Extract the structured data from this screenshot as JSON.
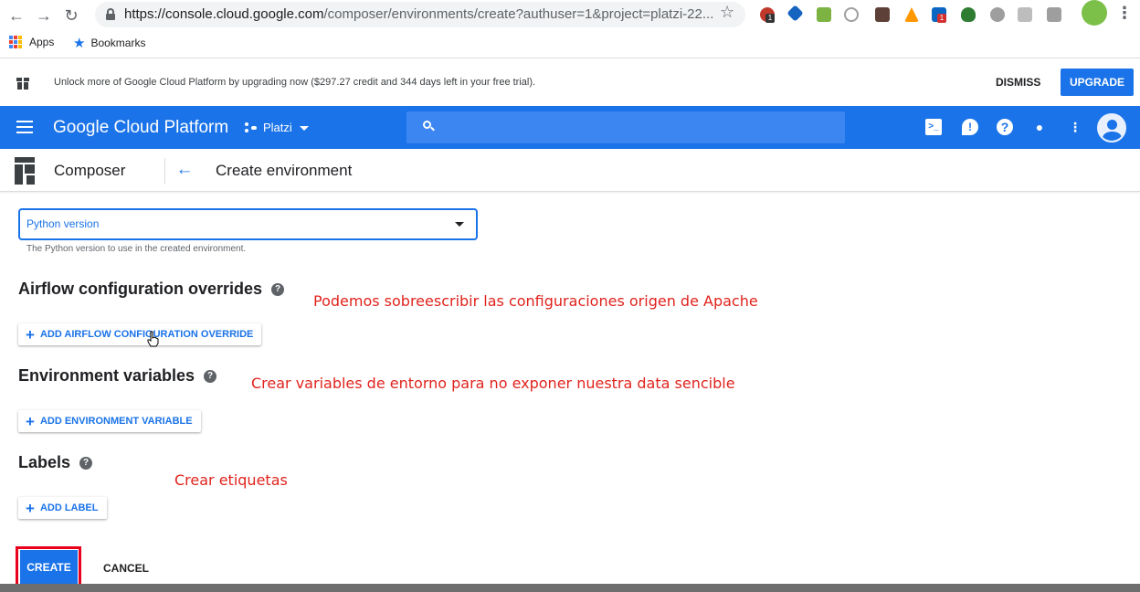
{
  "browser": {
    "url_host": "https://console.cloud.google.com",
    "url_path": "/composer/environments/create?authuser=1&project=platzi-22...",
    "bookmarks": {
      "apps_label": "Apps",
      "bookmarks_label": "Bookmarks"
    },
    "extension_badges": [
      "1",
      "1"
    ]
  },
  "banner": {
    "text": "Unlock more of Google Cloud Platform by upgrading now ($297.27 credit and 344 days left in your free trial).",
    "dismiss_label": "DISMISS",
    "upgrade_label": "UPGRADE"
  },
  "topbar": {
    "title": "Google Cloud Platform",
    "project": "Platzi",
    "brand_color": "#1a73e8"
  },
  "page_header": {
    "product": "Composer",
    "title": "Create environment"
  },
  "form": {
    "python_version": {
      "label": "Python version",
      "helper": "The Python version to use in the created environment."
    },
    "airflow_overrides": {
      "title": "Airflow configuration overrides",
      "button": "ADD AIRFLOW CONFIGURATION OVERRIDE"
    },
    "env_vars": {
      "title": "Environment variables",
      "button": "ADD ENVIRONMENT VARIABLE"
    },
    "labels": {
      "title": "Labels",
      "button": "ADD LABEL"
    },
    "create_label": "CREATE",
    "cancel_label": "CANCEL"
  },
  "annotations": {
    "overrides": "Podemos sobreescribir las configuraciones origen de Apache",
    "env_vars": "Crear variables de entorno para no exponer nuestra data sencible",
    "labels": "Crear etiquetas",
    "annotation_color": "#e0231d"
  }
}
